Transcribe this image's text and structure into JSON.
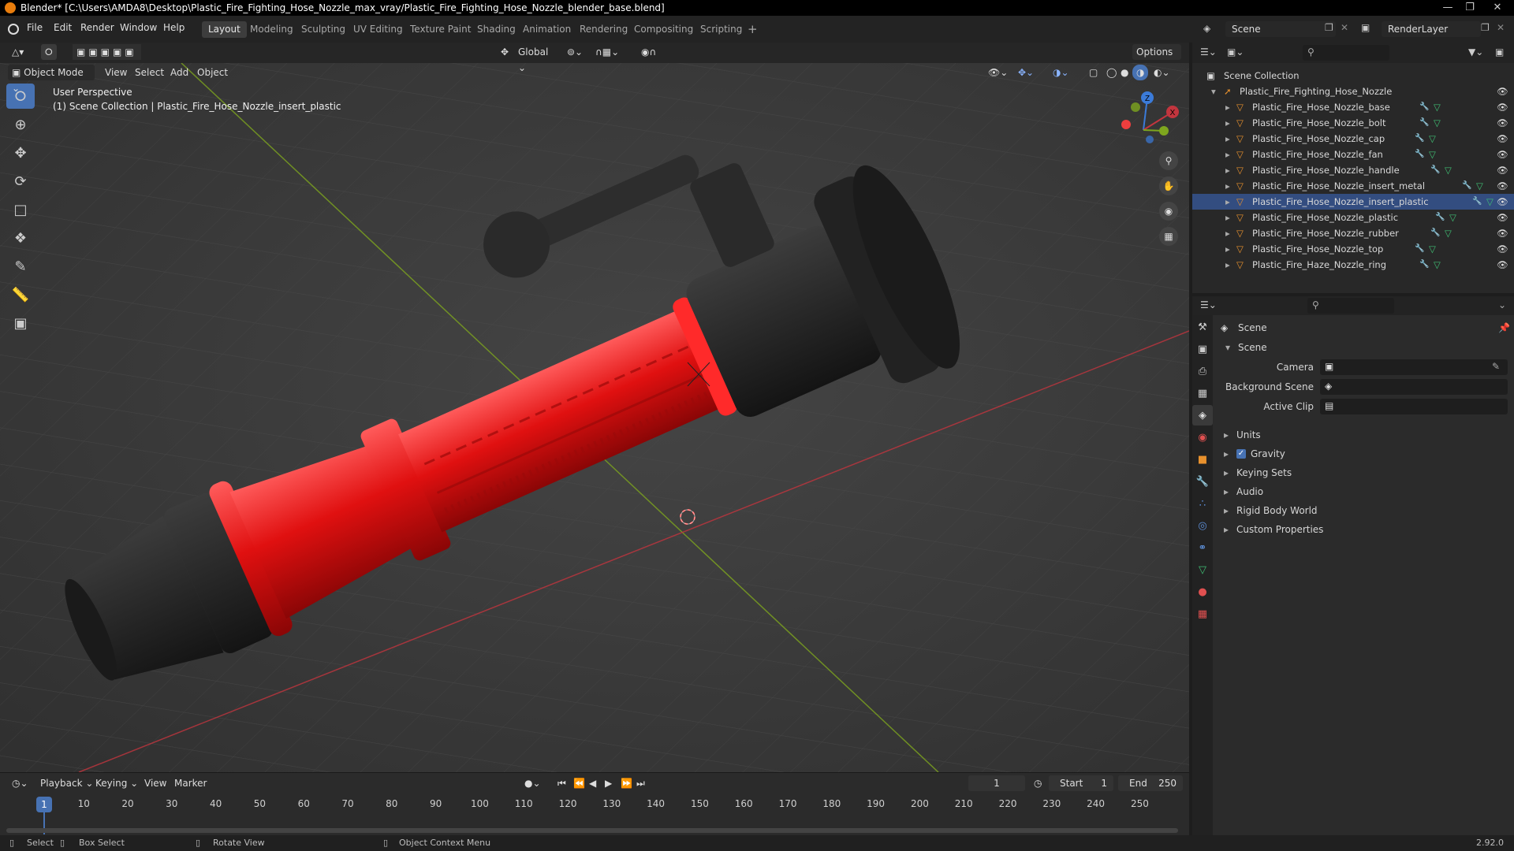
{
  "window": {
    "title": "Blender* [C:\\Users\\AMDA8\\Desktop\\Plastic_Fire_Fighting_Hose_Nozzle_max_vray/Plastic_Fire_Fighting_Hose_Nozzle_blender_base.blend]"
  },
  "menus": [
    "File",
    "Edit",
    "Render",
    "Window",
    "Help"
  ],
  "workspaces": [
    "Layout",
    "Modeling",
    "Sculpting",
    "UV Editing",
    "Texture Paint",
    "Shading",
    "Animation",
    "Rendering",
    "Compositing",
    "Scripting"
  ],
  "active_workspace": "Layout",
  "scene_field": "Scene",
  "renderlayer_field": "RenderLayer",
  "viewport": {
    "transform_orientation": "Global",
    "options_label": "Options",
    "mode": "Object Mode",
    "header_menus": [
      "View",
      "Select",
      "Add",
      "Object"
    ],
    "overlay_title": "User Perspective",
    "overlay_subtitle": "(1) Scene Collection | Plastic_Fire_Hose_Nozzle_insert_plastic",
    "gizmo_axes": [
      "Z",
      "X",
      "Y"
    ]
  },
  "timeline": {
    "menus": [
      "Playback",
      "Keying",
      "View",
      "Marker"
    ],
    "current_frame": "1",
    "start_label": "Start",
    "start": "1",
    "end_label": "End",
    "end": "250",
    "ticks": [
      "1",
      "10",
      "20",
      "30",
      "40",
      "50",
      "60",
      "70",
      "80",
      "90",
      "100",
      "110",
      "120",
      "130",
      "140",
      "150",
      "160",
      "170",
      "180",
      "190",
      "200",
      "210",
      "220",
      "230",
      "240",
      "250"
    ]
  },
  "outliner": {
    "root": "Scene Collection",
    "collection": "Plastic_Fire_Fighting_Hose_Nozzle",
    "objects": [
      "Plastic_Fire_Hose_Nozzle_base",
      "Plastic_Fire_Hose_Nozzle_bolt",
      "Plastic_Fire_Hose_Nozzle_cap",
      "Plastic_Fire_Hose_Nozzle_fan",
      "Plastic_Fire_Hose_Nozzle_handle",
      "Plastic_Fire_Hose_Nozzle_insert_metal",
      "Plastic_Fire_Hose_Nozzle_insert_plastic",
      "Plastic_Fire_Hose_Nozzle_plastic",
      "Plastic_Fire_Hose_Nozzle_rubber",
      "Plastic_Fire_Hose_Nozzle_top",
      "Plastic_Fire_Haze_Nozzle_ring"
    ],
    "selected_index": 6
  },
  "properties": {
    "context": "Scene",
    "panel": "Scene",
    "fields": [
      {
        "label": "Camera"
      },
      {
        "label": "Background Scene"
      },
      {
        "label": "Active Clip"
      }
    ],
    "subpanels": [
      "Units",
      "Gravity",
      "Keying Sets",
      "Audio",
      "Rigid Body World",
      "Custom Properties"
    ],
    "gravity_checked": true
  },
  "status": {
    "items": [
      "Select",
      "Box Select",
      "Rotate View",
      "Object Context Menu"
    ],
    "version": "2.92.0"
  },
  "colors": {
    "accent": "#4772b3",
    "x_axis": "#c2353e",
    "y_axis": "#7ea61e",
    "z_axis": "#3b7bd9",
    "nozzle_red": "#e01010",
    "object_orange": "#e8912d",
    "data_green": "#3fbf74"
  }
}
